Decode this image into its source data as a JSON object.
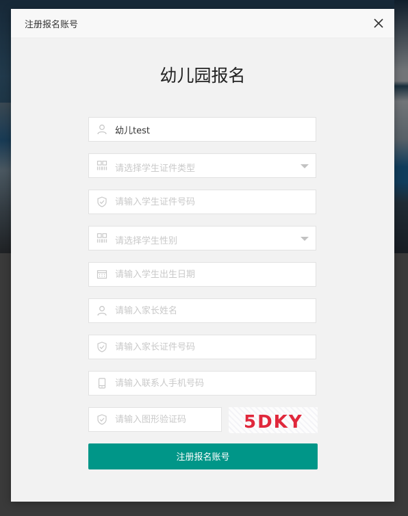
{
  "modal": {
    "title": "注册报名账号",
    "heading": "幼儿园报名"
  },
  "form": {
    "child_name": {
      "value": "幼儿test",
      "icon": "user-icon"
    },
    "id_type": {
      "placeholder": "请选择学生证件类型",
      "icon": "grid-icon"
    },
    "id_number": {
      "placeholder": "请输入学生证件号码",
      "icon": "shield-icon"
    },
    "gender": {
      "placeholder": "请选择学生性别",
      "icon": "grid-icon"
    },
    "birth_date": {
      "placeholder": "请输入学生出生日期",
      "icon": "calendar-icon"
    },
    "parent_name": {
      "placeholder": "请输入家长姓名",
      "icon": "user-icon"
    },
    "parent_id": {
      "placeholder": "请输入家长证件号码",
      "icon": "shield-icon"
    },
    "phone": {
      "placeholder": "请输入联系人手机号码",
      "icon": "phone-icon"
    },
    "captcha": {
      "placeholder": "请输入图形验证码",
      "icon": "shield-icon",
      "image_text": "5DKY"
    },
    "submit_label": "注册报名账号"
  },
  "colors": {
    "primary": "#009688",
    "captcha_text": "#e0283c"
  }
}
